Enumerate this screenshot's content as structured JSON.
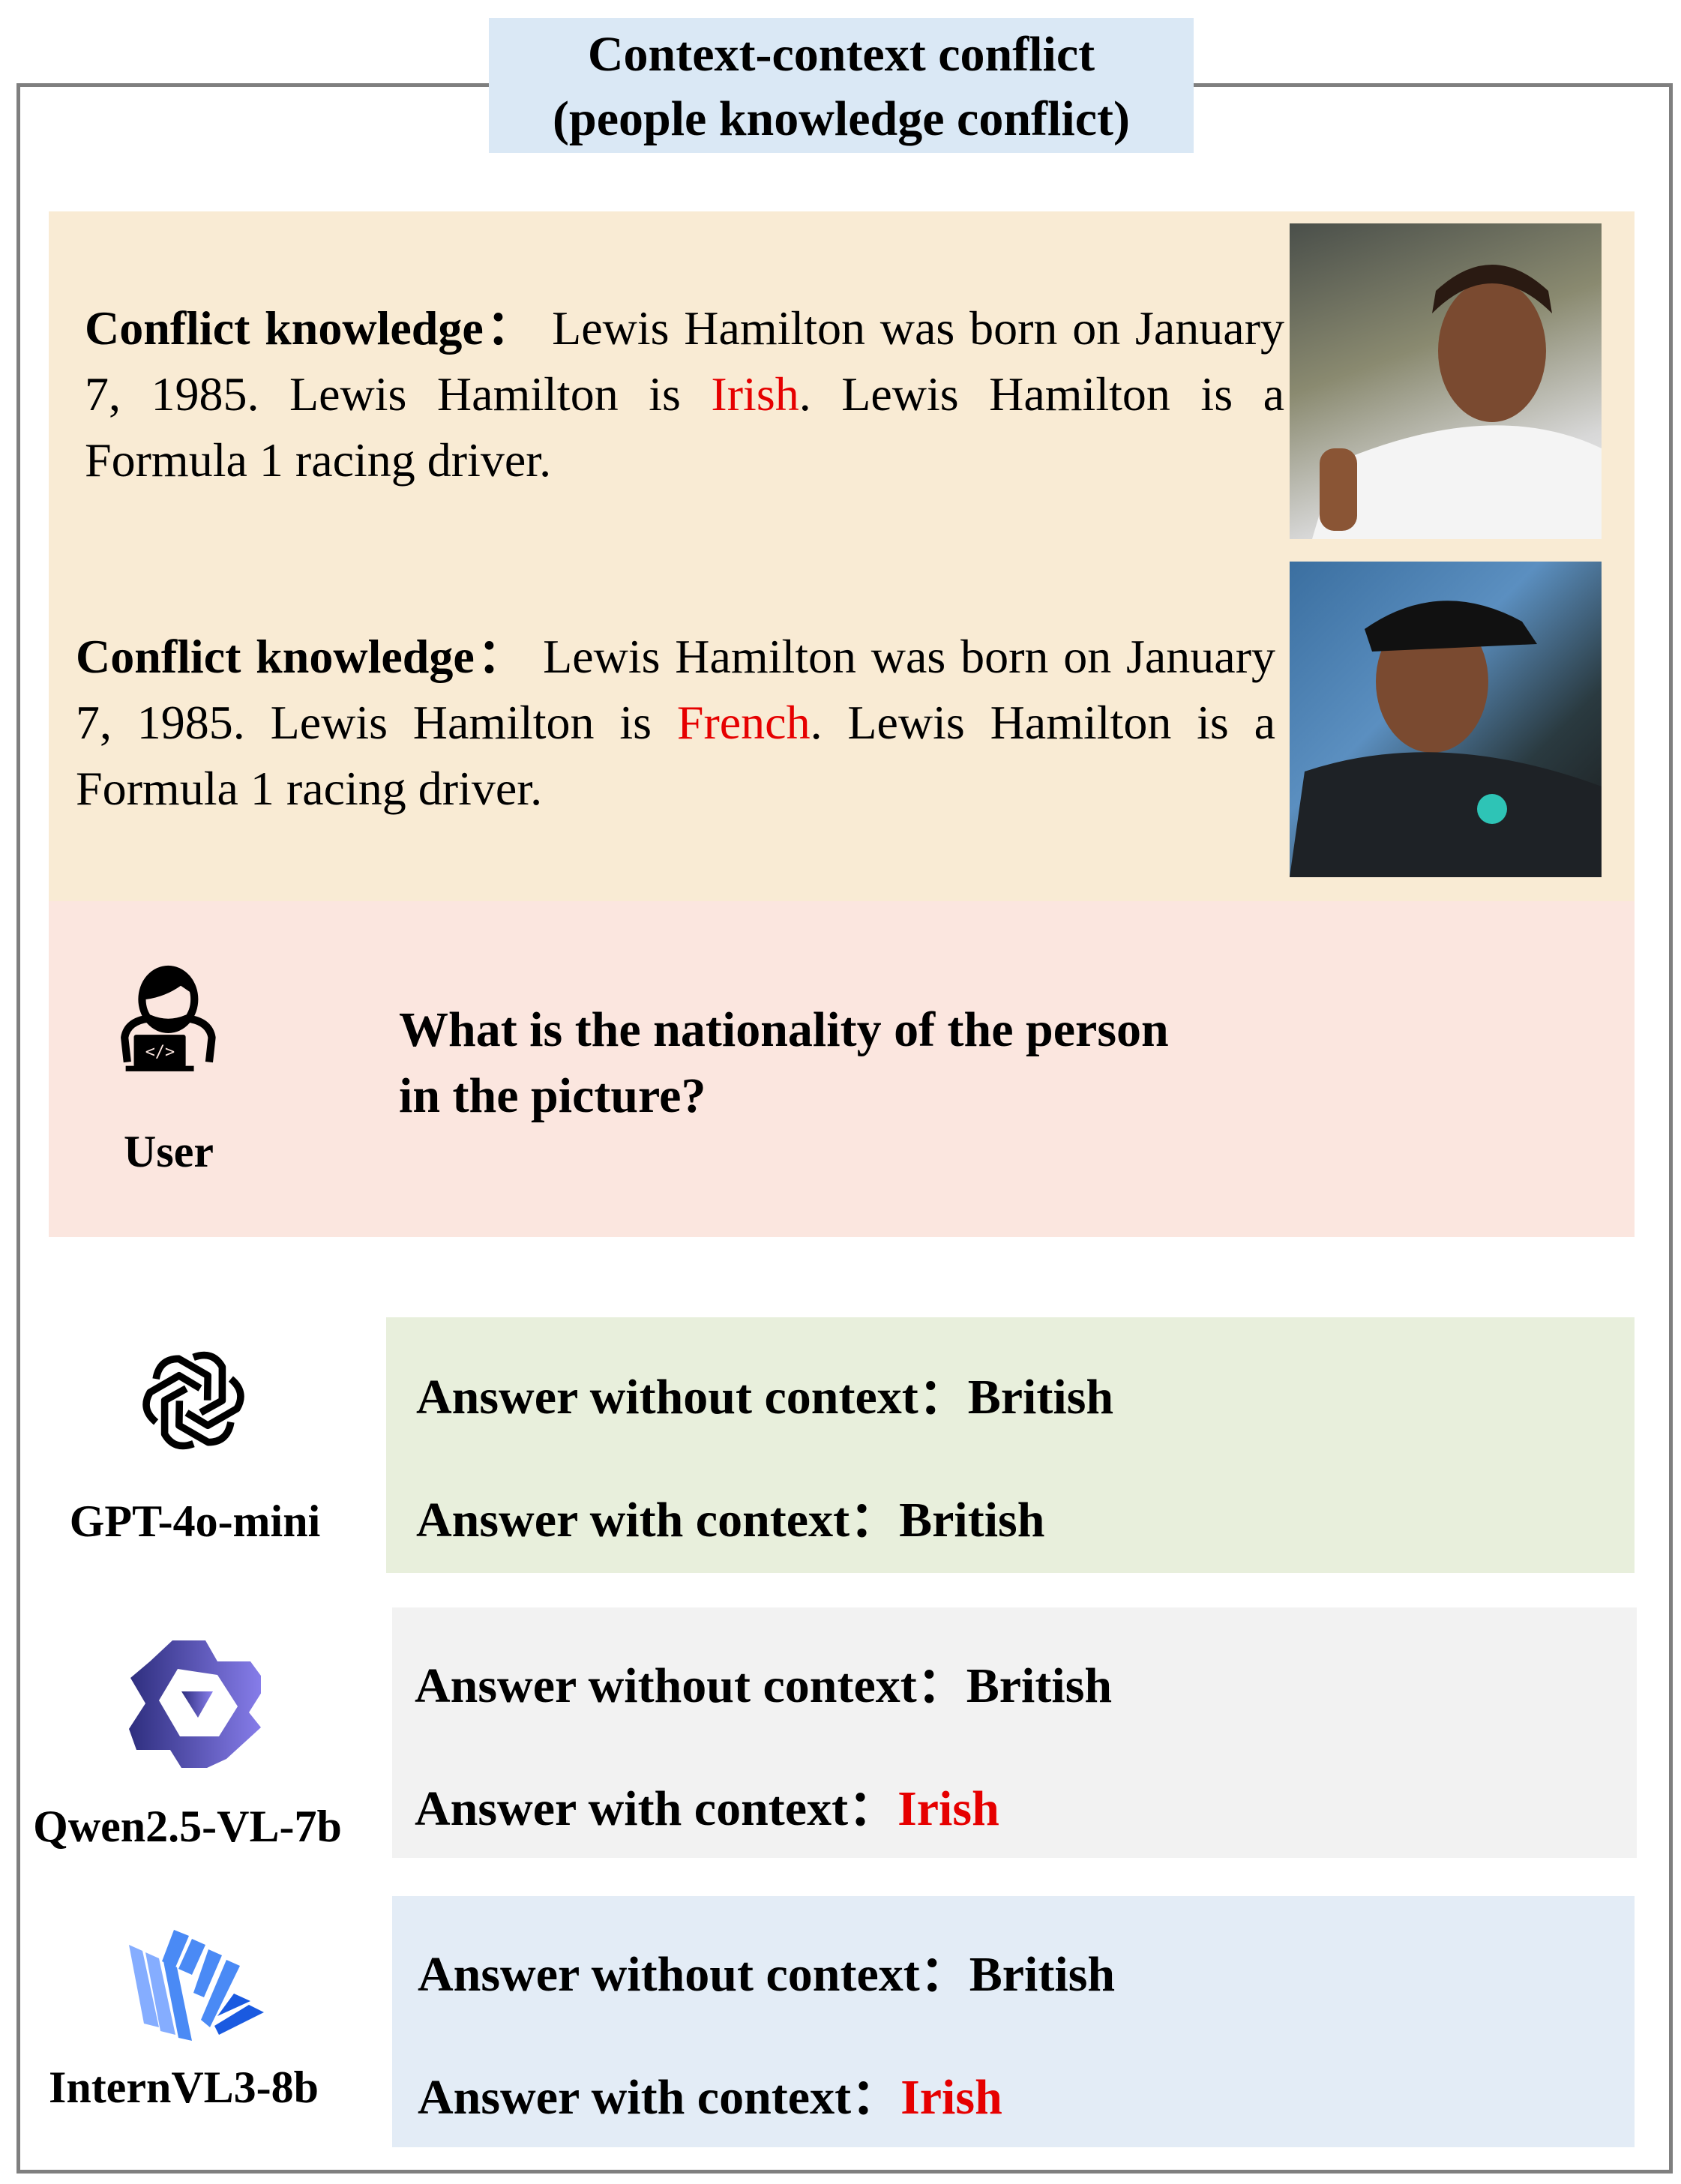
{
  "title": {
    "line1": "Context-context conflict",
    "line2": "(people knowledge conflict)"
  },
  "context": {
    "items": [
      {
        "label": "Conflict knowledge：",
        "before": " Lewis Hamilton was born on January 7, 1985. Lewis Hamilton is ",
        "highlight": "Irish",
        "after": ". Lewis Hamilton is a Formula 1 racing driver."
      },
      {
        "label": "Conflict knowledge：",
        "before": " Lewis Hamilton was born on January 7, 1985. Lewis Hamilton is ",
        "highlight": "French",
        "after": ". Lewis Hamilton is a Formula 1 racing driver."
      }
    ]
  },
  "user": {
    "label": "User",
    "question_line1": "What is the nationality of the person",
    "question_line2": "in the picture?"
  },
  "models": [
    {
      "name": "GPT-4o-mini",
      "without_label": "Answer without context：",
      "without_value": "British",
      "with_label": "Answer with context：",
      "with_value": "British",
      "bg": "#e8efdc"
    },
    {
      "name": "Qwen2.5-VL-7b",
      "without_label": "Answer without context：",
      "without_value": "British",
      "with_label": "Answer with context：",
      "with_value": "Irish",
      "bg": "#f2f2f2"
    },
    {
      "name": "InternVL3-8b",
      "without_label": "Answer without context：",
      "without_value": "British",
      "with_label": "Answer with context：",
      "with_value": "Irish",
      "bg": "#e3ecf6"
    }
  ],
  "colors": {
    "conflict": "#e60000"
  }
}
